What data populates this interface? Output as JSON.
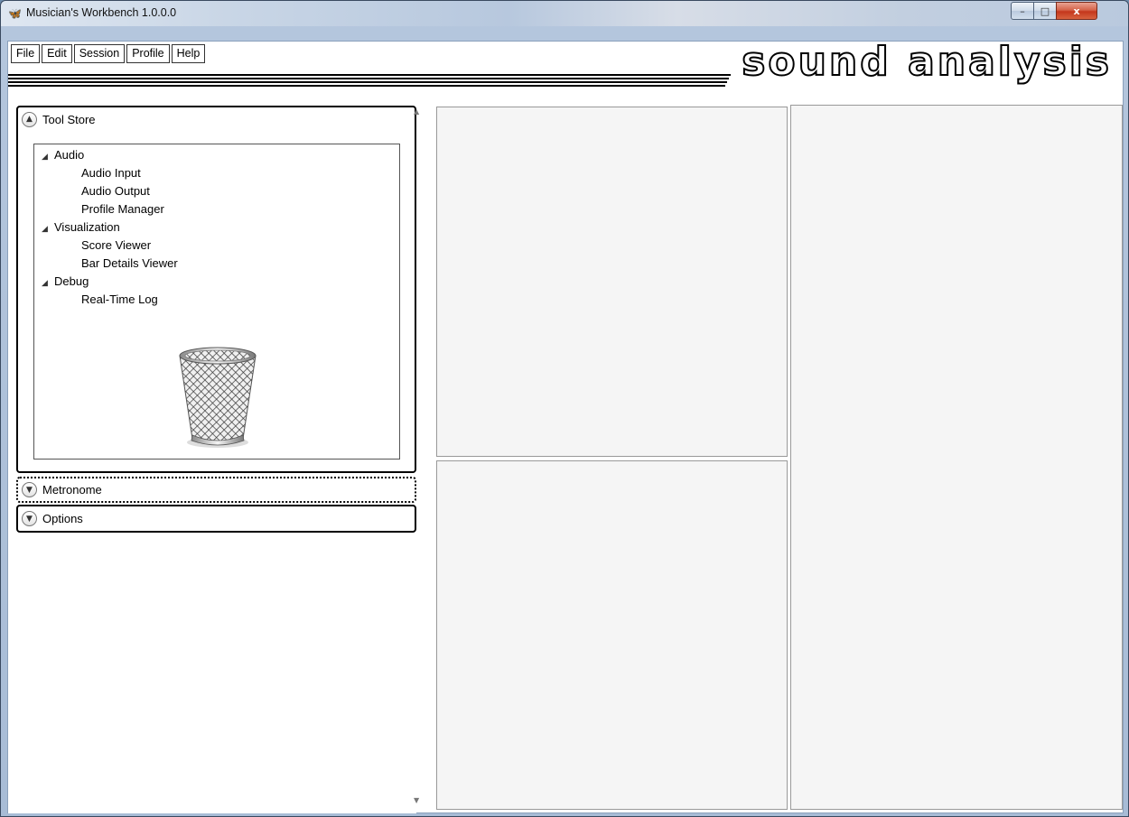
{
  "window": {
    "title": "Musician's Workbench 1.0.0.0",
    "controls": {
      "minimize": "–",
      "maximize": "□",
      "close": "x"
    }
  },
  "menu": [
    "File",
    "Edit",
    "Session",
    "Profile",
    "Help"
  ],
  "banner": {
    "text": "sound analysis"
  },
  "tool_store": {
    "title": "Tool Store",
    "tree": [
      {
        "label": "Audio",
        "children": [
          "Audio Input",
          "Audio Output",
          "Profile Manager"
        ]
      },
      {
        "label": "Visualization",
        "children": [
          "Score Viewer",
          "Bar Details Viewer"
        ]
      },
      {
        "label": "Debug",
        "children": [
          "Real-Time Log"
        ]
      }
    ],
    "recycle_icon": "trash-can-icon"
  },
  "metronome": {
    "title": "Metronome"
  },
  "options": {
    "title": "Options"
  },
  "icons": {
    "expand_up": "chevron-up-icon",
    "expand_down": "chevron-down-icon",
    "tree_expanded": "triangle-expanded-icon"
  }
}
